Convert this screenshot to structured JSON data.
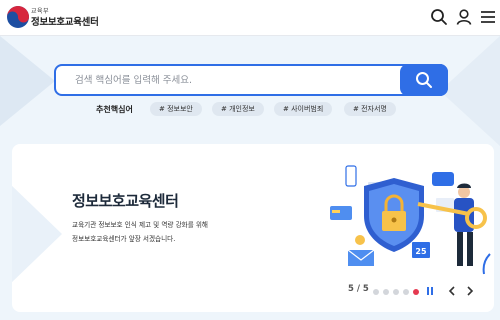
{
  "header": {
    "logo_small": "교육부",
    "logo_main": "정보보호교육센터",
    "icons": [
      "search-icon",
      "user-icon",
      "menu-icon"
    ]
  },
  "search": {
    "placeholder": "검색 핵심어를 입력해 주세요.",
    "value": ""
  },
  "recommended": {
    "label": "추천핵심어",
    "tags": [
      "# 정보보안",
      "# 개인정보",
      "# 사이버범죄",
      "# 전자서명"
    ]
  },
  "banner": {
    "title": "정보보호교육센터",
    "desc_line1": "교육기관 정보보호 인식 제고 및 역량 강화를 위해",
    "desc_line2": "정보보호교육센터가 앞장 서겠습니다.",
    "illustration_number": "25"
  },
  "slider": {
    "pager": "5 / 5",
    "current": 5,
    "total": 5
  },
  "colors": {
    "accent": "#2f6ee6",
    "active_dot": "#e53950",
    "background": "#eef5fb"
  }
}
